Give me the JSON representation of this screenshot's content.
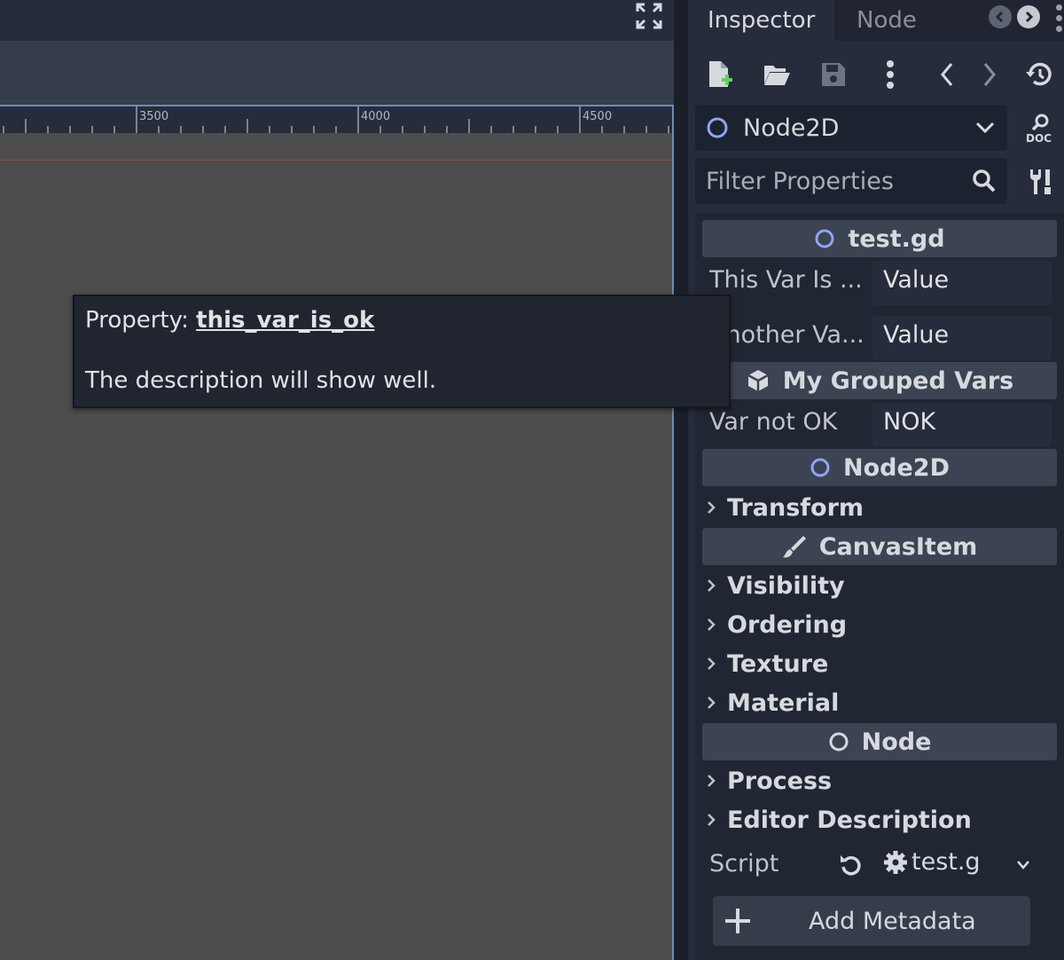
{
  "viewport": {
    "ruler_labels": [
      "3500",
      "4000",
      "4500"
    ]
  },
  "tooltip": {
    "prefix": "Property: ",
    "property_name": "this_var_is_ok",
    "description": "The description will show well."
  },
  "inspector": {
    "tabs": [
      "Inspector",
      "Node"
    ],
    "class_name": "Node2D",
    "filter_placeholder": "Filter Properties",
    "sections": {
      "script": "test.gd",
      "grouped": "My Grouped Vars",
      "node2d": "Node2D",
      "canvas": "CanvasItem",
      "node": "Node"
    },
    "props": [
      {
        "name": "This Var Is ...",
        "value": "Value"
      },
      {
        "name": "Another Va...",
        "value": "Value"
      },
      {
        "name": "Var not OK",
        "value": "NOK"
      }
    ],
    "groups": {
      "transform": "Transform",
      "visibility": "Visibility",
      "ordering": "Ordering",
      "texture": "Texture",
      "material": "Material",
      "process": "Process",
      "editor_description": "Editor Description"
    },
    "script_label": "Script",
    "script_value": "test.g",
    "add_metadata": "Add Metadata"
  },
  "colors": {
    "accent_blue": "#8da5f3",
    "panel": "#262c3b",
    "viewport_bg": "#4d4d4d"
  }
}
